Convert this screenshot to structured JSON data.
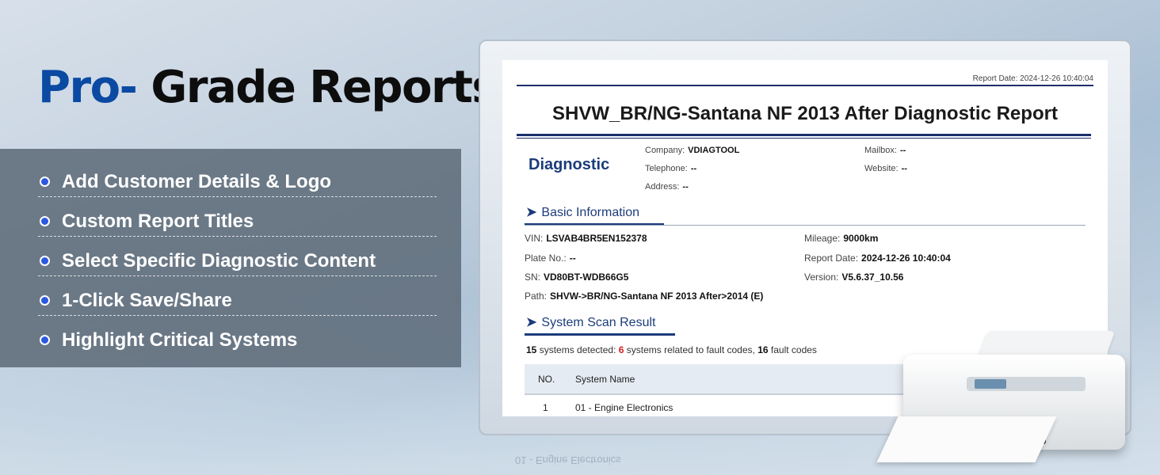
{
  "headline": {
    "accent": "Pro-",
    "rest": "Grade Reports"
  },
  "features": [
    "Add Customer Details & Logo",
    "Custom Report Titles",
    "Select Specific Diagnostic Content",
    "1-Click Save/Share",
    "Highlight Critical Systems"
  ],
  "report": {
    "report_date_line": "Report Date: 2024-12-26 10:40:04",
    "title": "SHVW_BR/NG-Santana NF 2013 After  Diagnostic Report",
    "logo_text": "Diagnostic",
    "company": {
      "label": "Company:",
      "value": "VDIAGTOOL"
    },
    "telephone": {
      "label": "Telephone:",
      "value": "--"
    },
    "address": {
      "label": "Address:",
      "value": "--"
    },
    "mailbox": {
      "label": "Mailbox:",
      "value": "--"
    },
    "website": {
      "label": "Website:",
      "value": "--"
    },
    "basic_info": {
      "heading": "Basic Information",
      "vin": {
        "label": "VIN:",
        "value": "LSVAB4BR5EN152378"
      },
      "plate": {
        "label": "Plate No.:",
        "value": "--"
      },
      "sn": {
        "label": "SN:",
        "value": "VD80BT-WDB66G5"
      },
      "path": {
        "label": "Path:",
        "value": "SHVW->BR/NG-Santana NF 2013 After>2014 (E)"
      },
      "mileage": {
        "label": "Mileage:",
        "value": "9000km"
      },
      "report_date": {
        "label": "Report Date:",
        "value": "2024-12-26 10:40:04"
      },
      "version": {
        "label": "Version:",
        "value": "V5.6.37_10.56"
      }
    },
    "scan": {
      "heading": "System Scan Result",
      "summary": {
        "detected_count": "15",
        "detected_text": " systems detected: ",
        "fault_systems": "6",
        "fault_systems_text": " systems related to fault codes, ",
        "fault_codes": "16",
        "fault_codes_text": " fault codes"
      },
      "columns": [
        "NO.",
        "System Name"
      ],
      "rows": [
        {
          "no": "1",
          "name": "01 - Engine Electronics"
        }
      ]
    }
  },
  "reflection_text": "01 - Engine Electronics",
  "colors": {
    "accent_blue": "#0b4aa3",
    "fault_red": "#d41e1e",
    "report_navy": "#1c2e6a"
  }
}
